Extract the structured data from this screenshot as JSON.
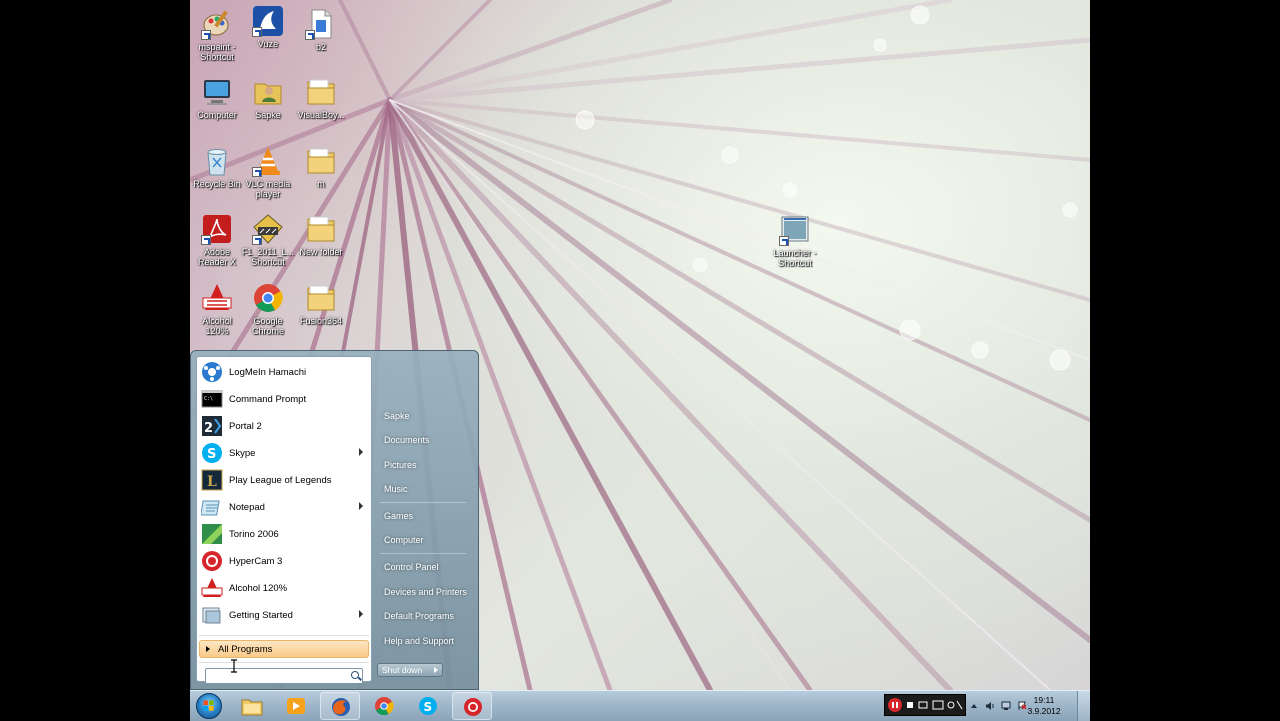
{
  "desktop": {
    "icons": [
      {
        "label": "mspaint - Shortcut",
        "icon": "paint-icon"
      },
      {
        "label": "Vuze",
        "icon": "vuze-icon"
      },
      {
        "label": "b2",
        "icon": "file-icon"
      },
      {
        "label": "Computer",
        "icon": "computer-icon"
      },
      {
        "label": "Sapke",
        "icon": "user-folder-icon"
      },
      {
        "label": "VisualBoy...",
        "icon": "folder-icon"
      },
      {
        "label": "Recycle Bin",
        "icon": "recycle-bin-icon"
      },
      {
        "label": "VLC media player",
        "icon": "vlc-icon"
      },
      {
        "label": "m",
        "icon": "folder-icon"
      },
      {
        "label": "Adobe Reader X",
        "icon": "adobe-reader-icon"
      },
      {
        "label": "F1_2011_L... Shortcut",
        "icon": "f1-game-icon"
      },
      {
        "label": "New folder",
        "icon": "folder-icon"
      },
      {
        "label": "Alcohol 120%",
        "icon": "alcohol-icon"
      },
      {
        "label": "Google Chrome",
        "icon": "chrome-icon"
      },
      {
        "label": "Fusion364",
        "icon": "folder-icon"
      },
      {
        "label": "Launcher - Shortcut",
        "icon": "launcher-icon"
      }
    ]
  },
  "start_menu": {
    "programs": [
      {
        "label": "LogMeIn Hamachi",
        "icon": "hamachi-icon",
        "submenu": false
      },
      {
        "label": "Command Prompt",
        "icon": "command-prompt-icon",
        "submenu": false
      },
      {
        "label": "Portal 2",
        "icon": "portal-icon",
        "submenu": false
      },
      {
        "label": "Skype",
        "icon": "skype-icon",
        "submenu": true
      },
      {
        "label": "Play League of Legends",
        "icon": "league-icon",
        "submenu": false
      },
      {
        "label": "Notepad",
        "icon": "notepad-icon",
        "submenu": true
      },
      {
        "label": "Torino 2006",
        "icon": "torino-icon",
        "submenu": false
      },
      {
        "label": "HyperCam 3",
        "icon": "hypercam-icon",
        "submenu": false
      },
      {
        "label": "Alcohol 120%",
        "icon": "alcohol-icon",
        "submenu": false
      },
      {
        "label": "Getting Started",
        "icon": "getting-started-icon",
        "submenu": true
      }
    ],
    "all_programs_label": "All Programs",
    "search_placeholder": "",
    "right_items": [
      {
        "label": "Sapke"
      },
      {
        "label": "Documents"
      },
      {
        "label": "Pictures"
      },
      {
        "label": "Music"
      },
      {
        "label": "Games"
      },
      {
        "label": "Computer"
      },
      {
        "label": "Control Panel"
      },
      {
        "label": "Devices and Printers"
      },
      {
        "label": "Default Programs"
      },
      {
        "label": "Help and Support"
      }
    ],
    "shutdown_label": "Shut down"
  },
  "taskbar": {
    "pinned": [
      {
        "name": "explorer-icon",
        "active": false
      },
      {
        "name": "media-player-icon",
        "active": false
      },
      {
        "name": "firefox-icon",
        "active": true
      },
      {
        "name": "chrome-icon",
        "active": false
      },
      {
        "name": "skype-icon",
        "active": false
      },
      {
        "name": "hypercam-icon",
        "active": true
      }
    ],
    "clock_time": "19:11",
    "clock_date": "3.9.2012"
  },
  "colors": {
    "start_menu_frame": "#8ea4b1",
    "taskbar": "#a3bacd",
    "all_programs_highlight": "#f9c98a"
  }
}
